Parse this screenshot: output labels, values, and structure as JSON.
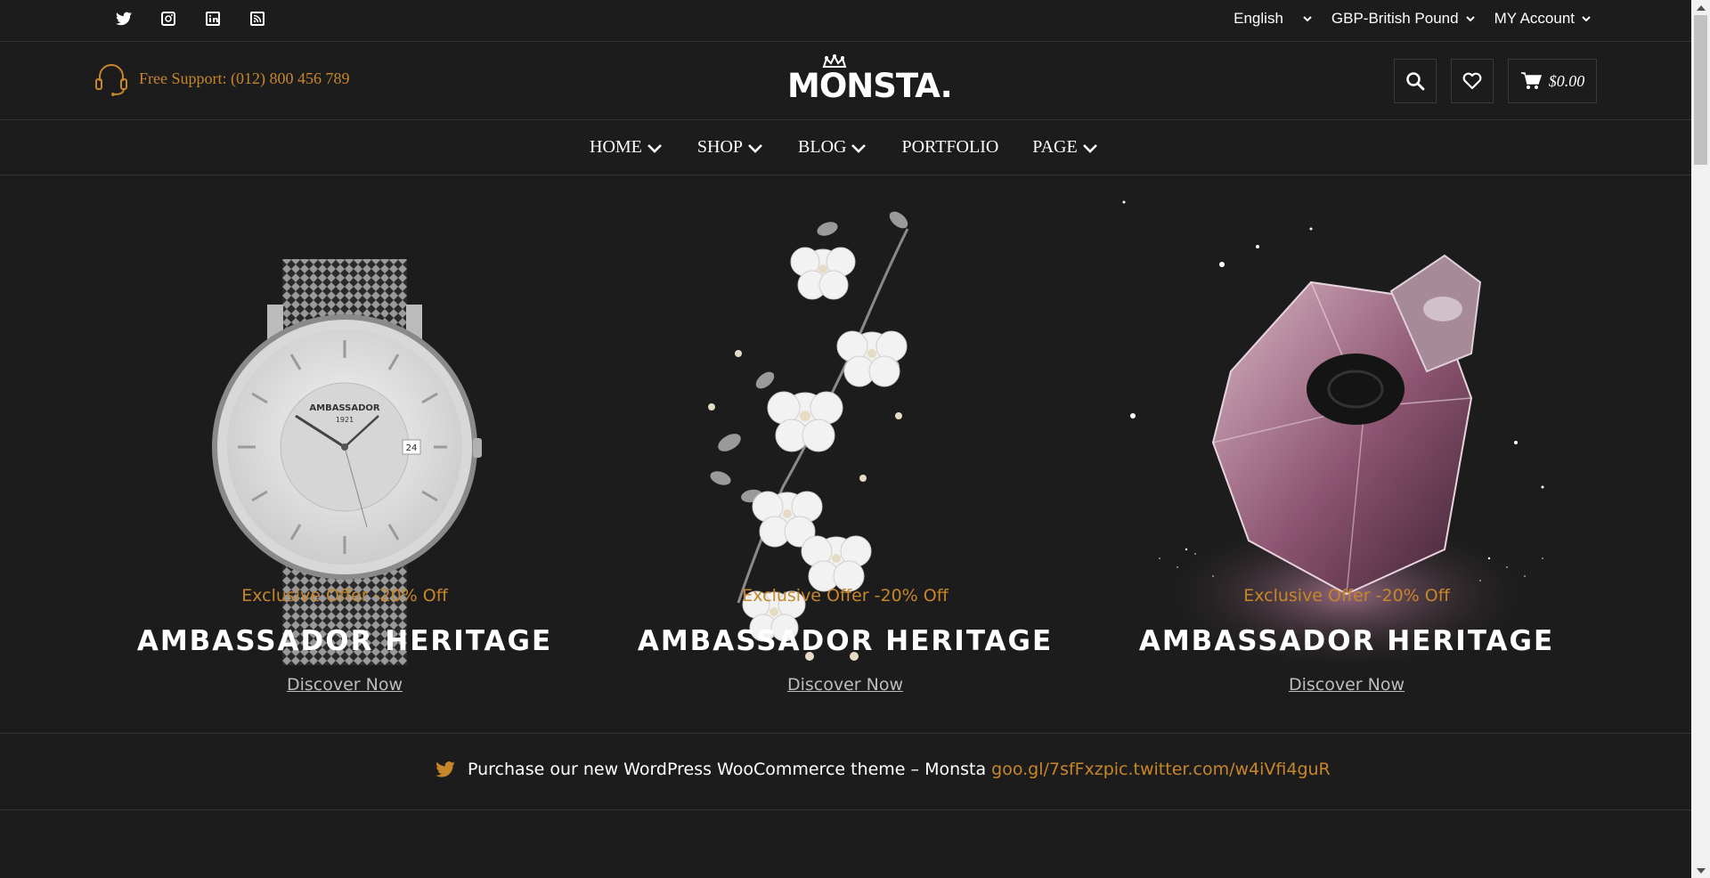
{
  "topbar": {
    "social": [
      {
        "name": "twitter-icon"
      },
      {
        "name": "instagram-icon"
      },
      {
        "name": "linkedin-icon"
      },
      {
        "name": "rss-icon"
      }
    ],
    "language": "English",
    "currency": "GBP-British Pound",
    "account": "MY Account"
  },
  "header": {
    "support": "Free Support: (012) 800 456 789",
    "logo": "MONSTA.",
    "cart_total": "$0.00"
  },
  "nav": {
    "items": [
      {
        "label": "HOME",
        "has_dropdown": true
      },
      {
        "label": "SHOP",
        "has_dropdown": true
      },
      {
        "label": "BLOG",
        "has_dropdown": true
      },
      {
        "label": "PORTFOLIO",
        "has_dropdown": false
      },
      {
        "label": "PAGE",
        "has_dropdown": true
      }
    ]
  },
  "banners": [
    {
      "offer": "Exclusive Offer -20% Off",
      "title": "AMBASSADOR HERITAGE",
      "cta": "Discover Now",
      "image": "silver-mesh-watch"
    },
    {
      "offer": "Exclusive Offer -20% Off",
      "title": "AMBASSADOR HERITAGE",
      "cta": "Discover Now",
      "image": "pearl-flower-hairpiece"
    },
    {
      "offer": "Exclusive Offer -20% Off",
      "title": "AMBASSADOR HERITAGE",
      "cta": "Discover Now",
      "image": "pink-perfume-bottle"
    }
  ],
  "tweet": {
    "text": "Purchase our new WordPress WooCommerce theme – Monsta",
    "link": "goo.gl/7sfFxzpic.twitter.com/w4iVfi4guR"
  },
  "colors": {
    "background": "#1c1c1c",
    "accent": "#c8862a",
    "text": "#ffffff",
    "divider": "#333333"
  }
}
